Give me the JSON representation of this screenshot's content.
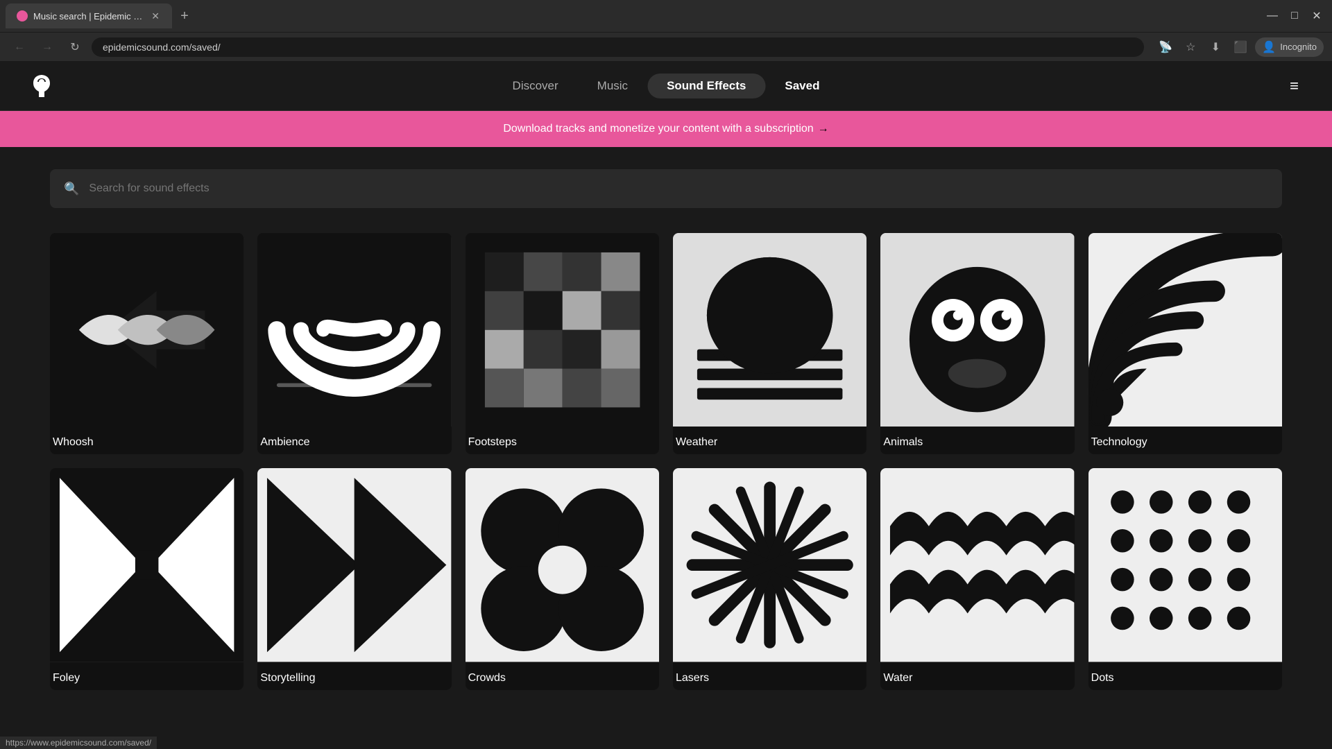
{
  "browser": {
    "tab_title": "Music search | Epidemic Sound",
    "tab_favicon_color": "#e8579b",
    "address": "epidemicsound.com/saved/",
    "new_tab_icon": "+",
    "window_minimize": "−",
    "window_maximize": "□",
    "window_close": "✕",
    "incognito_label": "Incognito",
    "nav_back": "←",
    "nav_forward": "→",
    "nav_reload": "↻"
  },
  "nav": {
    "links": [
      {
        "id": "discover",
        "label": "Discover",
        "active": false
      },
      {
        "id": "music",
        "label": "Music",
        "active": false
      },
      {
        "id": "sound-effects",
        "label": "Sound Effects",
        "active": true
      },
      {
        "id": "saved",
        "label": "Saved",
        "active": false
      }
    ],
    "menu_icon": "≡"
  },
  "banner": {
    "text": "Download tracks and monetize your content with a subscription",
    "arrow": "→"
  },
  "search": {
    "placeholder": "Search for sound effects"
  },
  "categories": [
    {
      "id": "whoosh",
      "label": "Whoosh",
      "svg_type": "whoosh"
    },
    {
      "id": "ambience",
      "label": "Ambience",
      "svg_type": "ambience"
    },
    {
      "id": "footsteps",
      "label": "Footsteps",
      "svg_type": "footsteps"
    },
    {
      "id": "weather",
      "label": "Weather",
      "svg_type": "weather"
    },
    {
      "id": "animals",
      "label": "Animals",
      "svg_type": "animals"
    },
    {
      "id": "technology",
      "label": "Technology",
      "svg_type": "technology"
    },
    {
      "id": "foley",
      "label": "Foley",
      "svg_type": "foley"
    },
    {
      "id": "storytelling",
      "label": "Storytelling",
      "svg_type": "storytelling"
    },
    {
      "id": "crowds",
      "label": "Crowds",
      "svg_type": "crowds"
    },
    {
      "id": "lasers",
      "label": "Lasers",
      "svg_type": "lasers"
    },
    {
      "id": "water",
      "label": "Water",
      "svg_type": "water"
    },
    {
      "id": "dots",
      "label": "Dots",
      "svg_type": "dots"
    }
  ],
  "status_bar": {
    "url": "https://www.epidemicsound.com/saved/"
  }
}
